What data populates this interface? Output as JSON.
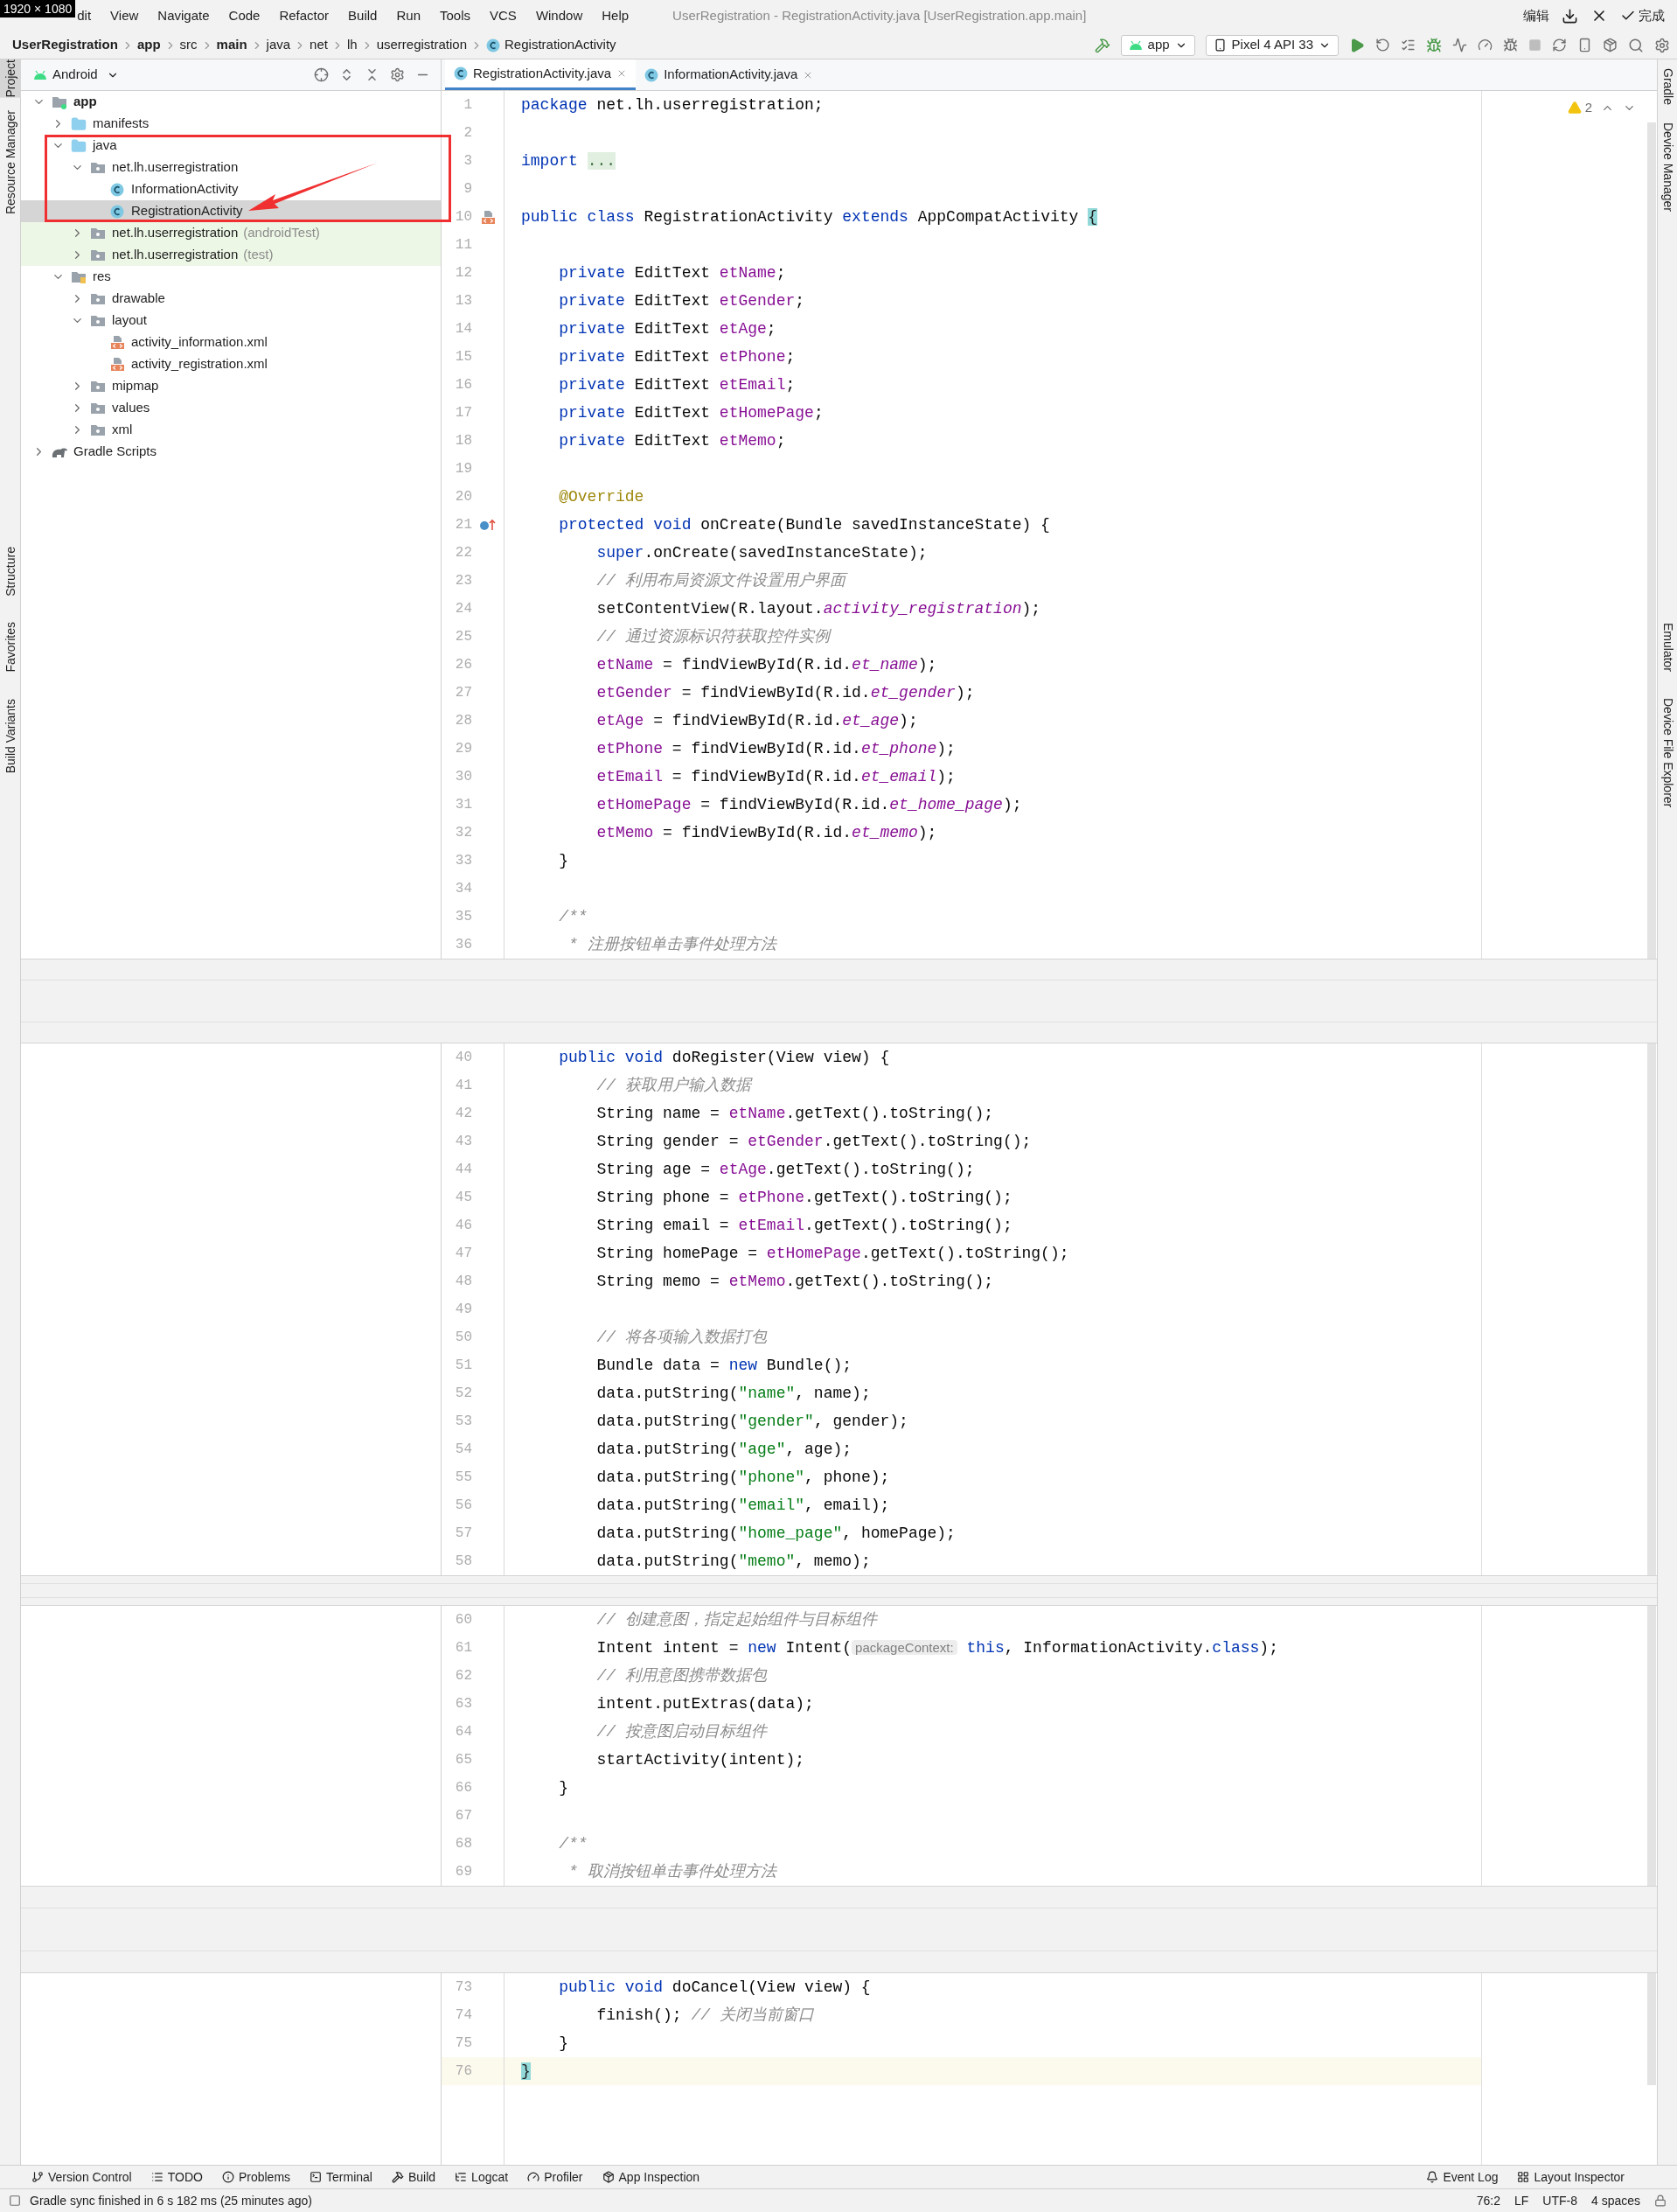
{
  "screen_capture": {
    "size_label": "1920 × 1080",
    "edit_label": "编辑",
    "done_label": "完成"
  },
  "menu": [
    "dit",
    "View",
    "Navigate",
    "Code",
    "Refactor",
    "Build",
    "Run",
    "Tools",
    "VCS",
    "Window",
    "Help"
  ],
  "window": {
    "title": "UserRegistration - RegistrationActivity.java [UserRegistration.app.main]"
  },
  "breadcrumbs": [
    {
      "label": "UserRegistration",
      "bold": true,
      "kind": "plain"
    },
    {
      "label": "app",
      "bold": true,
      "kind": "plain"
    },
    {
      "label": "src",
      "bold": false,
      "kind": "plain"
    },
    {
      "label": "main",
      "bold": true,
      "kind": "plain"
    },
    {
      "label": "java",
      "bold": false,
      "kind": "plain"
    },
    {
      "label": "net",
      "bold": false,
      "kind": "plain"
    },
    {
      "label": "lh",
      "bold": false,
      "kind": "plain"
    },
    {
      "label": "userregistration",
      "bold": false,
      "kind": "plain"
    },
    {
      "label": "RegistrationActivity",
      "bold": false,
      "kind": "class"
    }
  ],
  "toolbar": {
    "run_config": "app",
    "device": "Pixel 4 API 33"
  },
  "left_strip": [
    {
      "label": "Project",
      "selected": true
    },
    {
      "label": "Resource Manager",
      "selected": false
    },
    {
      "label": "Structure",
      "selected": false
    },
    {
      "label": "Favorites",
      "selected": false
    },
    {
      "label": "Build Variants",
      "selected": false
    }
  ],
  "right_strip": [
    {
      "label": "Gradle"
    },
    {
      "label": "Device Manager"
    },
    {
      "label": "Emulator"
    },
    {
      "label": "Device File Explorer"
    }
  ],
  "project": {
    "view": "Android",
    "tree": [
      {
        "label": "app",
        "kind": "module",
        "expanded": true,
        "selected": false,
        "children": [
          {
            "label": "manifests",
            "kind": "folder",
            "expanded": false,
            "selected": false
          },
          {
            "label": "java",
            "kind": "folder",
            "expanded": true,
            "selected": false,
            "children": [
              {
                "label": "net.lh.userregistration",
                "kind": "package",
                "expanded": true,
                "selected": false,
                "children": [
                  {
                    "label": "InformationActivity",
                    "kind": "class",
                    "selected": false
                  },
                  {
                    "label": "RegistrationActivity",
                    "kind": "class",
                    "selected": true
                  }
                ]
              },
              {
                "label": "net.lh.userregistration",
                "suffix": "(androidTest)",
                "kind": "test-package",
                "expanded": false,
                "selected": false
              },
              {
                "label": "net.lh.userregistration",
                "suffix": "(test)",
                "kind": "test-package",
                "expanded": false,
                "selected": false
              }
            ]
          },
          {
            "label": "res",
            "kind": "res-folder",
            "expanded": true,
            "selected": false,
            "children": [
              {
                "label": "drawable",
                "kind": "package",
                "expanded": false,
                "selected": false
              },
              {
                "label": "layout",
                "kind": "package",
                "expanded": true,
                "selected": false,
                "children": [
                  {
                    "label": "activity_information.xml",
                    "kind": "layout-xml",
                    "selected": false
                  },
                  {
                    "label": "activity_registration.xml",
                    "kind": "layout-xml",
                    "selected": false
                  }
                ]
              },
              {
                "label": "mipmap",
                "kind": "package",
                "expanded": false,
                "selected": false
              },
              {
                "label": "values",
                "kind": "package",
                "expanded": false,
                "selected": false
              },
              {
                "label": "xml",
                "kind": "package",
                "expanded": false,
                "selected": false
              }
            ]
          }
        ]
      },
      {
        "label": "Gradle Scripts",
        "kind": "gradle",
        "expanded": false,
        "selected": false
      }
    ]
  },
  "tabs": [
    {
      "label": "RegistrationActivity.java",
      "selected": true
    },
    {
      "label": "InformationActivity.java",
      "selected": false
    }
  ],
  "editor": {
    "warnings": "2",
    "segments": [
      {
        "lines": [
          {
            "number": "1",
            "tokens": [
              {
                "kind": "kw",
                "text": "package "
              },
              {
                "kind": "p",
                "text": "net.lh.userregistration;"
              }
            ]
          },
          {
            "number": "2"
          },
          {
            "number": "3",
            "tokens": [
              {
                "kind": "kw",
                "text": "import "
              },
              {
                "kind": "fold",
                "text": "..."
              }
            ]
          },
          {
            "number": "9"
          },
          {
            "number": "10",
            "kind": "layout-marker",
            "tokens": [
              {
                "kind": "kw",
                "text": "public class "
              },
              {
                "kind": "p",
                "text": "RegistrationActivity "
              },
              {
                "kind": "kw",
                "text": "extends "
              },
              {
                "kind": "p",
                "text": "AppCompatActivity "
              },
              {
                "kind": "brace",
                "text": "{"
              }
            ]
          },
          {
            "number": "11"
          },
          {
            "number": "12",
            "tokens": [
              {
                "kind": "kw",
                "text": "    private "
              },
              {
                "kind": "p",
                "text": "EditText "
              },
              {
                "kind": "fld",
                "text": "etName"
              },
              {
                "kind": "p",
                "text": ";"
              }
            ]
          },
          {
            "number": "13",
            "tokens": [
              {
                "kind": "kw",
                "text": "    private "
              },
              {
                "kind": "p",
                "text": "EditText "
              },
              {
                "kind": "fld",
                "text": "etGender"
              },
              {
                "kind": "p",
                "text": ";"
              }
            ]
          },
          {
            "number": "14",
            "tokens": [
              {
                "kind": "kw",
                "text": "    private "
              },
              {
                "kind": "p",
                "text": "EditText "
              },
              {
                "kind": "fld",
                "text": "etAge"
              },
              {
                "kind": "p",
                "text": ";"
              }
            ]
          },
          {
            "number": "15",
            "tokens": [
              {
                "kind": "kw",
                "text": "    private "
              },
              {
                "kind": "p",
                "text": "EditText "
              },
              {
                "kind": "fld",
                "text": "etPhone"
              },
              {
                "kind": "p",
                "text": ";"
              }
            ]
          },
          {
            "number": "16",
            "tokens": [
              {
                "kind": "kw",
                "text": "    private "
              },
              {
                "kind": "p",
                "text": "EditText "
              },
              {
                "kind": "fld",
                "text": "etEmail"
              },
              {
                "kind": "p",
                "text": ";"
              }
            ]
          },
          {
            "number": "17",
            "tokens": [
              {
                "kind": "kw",
                "text": "    private "
              },
              {
                "kind": "p",
                "text": "EditText "
              },
              {
                "kind": "fld",
                "text": "etHomePage"
              },
              {
                "kind": "p",
                "text": ";"
              }
            ]
          },
          {
            "number": "18",
            "tokens": [
              {
                "kind": "kw",
                "text": "    private "
              },
              {
                "kind": "p",
                "text": "EditText "
              },
              {
                "kind": "fld",
                "text": "etMemo"
              },
              {
                "kind": "p",
                "text": ";"
              }
            ]
          },
          {
            "number": "19"
          },
          {
            "number": "20",
            "tokens": [
              {
                "kind": "ann",
                "text": "    @Override"
              }
            ]
          },
          {
            "number": "21",
            "kind": "override-marker",
            "tokens": [
              {
                "kind": "kw",
                "text": "    protected void "
              },
              {
                "kind": "p",
                "text": "onCreate(Bundle savedInstanceState) {"
              }
            ]
          },
          {
            "number": "22",
            "tokens": [
              {
                "kind": "kw",
                "text": "        super"
              },
              {
                "kind": "p",
                "text": ".onCreate(savedInstanceState);"
              }
            ]
          },
          {
            "number": "23",
            "tokens": [
              {
                "kind": "cm",
                "text": "        // 利用布局资源文件设置用户界面"
              }
            ]
          },
          {
            "number": "24",
            "tokens": [
              {
                "kind": "p",
                "text": "        setContentView(R.layout."
              },
              {
                "kind": "ifld",
                "text": "activity_registration"
              },
              {
                "kind": "p",
                "text": ");"
              }
            ]
          },
          {
            "number": "25",
            "tokens": [
              {
                "kind": "cm",
                "text": "        // 通过资源标识符获取控件实例"
              }
            ]
          },
          {
            "number": "26",
            "tokens": [
              {
                "kind": "fld",
                "text": "        etName"
              },
              {
                "kind": "p",
                "text": " = findViewById(R.id."
              },
              {
                "kind": "ifld",
                "text": "et_name"
              },
              {
                "kind": "p",
                "text": ");"
              }
            ]
          },
          {
            "number": "27",
            "tokens": [
              {
                "kind": "fld",
                "text": "        etGender"
              },
              {
                "kind": "p",
                "text": " = findViewById(R.id."
              },
              {
                "kind": "ifld",
                "text": "et_gender"
              },
              {
                "kind": "p",
                "text": ");"
              }
            ]
          },
          {
            "number": "28",
            "tokens": [
              {
                "kind": "fld",
                "text": "        etAge"
              },
              {
                "kind": "p",
                "text": " = findViewById(R.id."
              },
              {
                "kind": "ifld",
                "text": "et_age"
              },
              {
                "kind": "p",
                "text": ");"
              }
            ]
          },
          {
            "number": "29",
            "tokens": [
              {
                "kind": "fld",
                "text": "        etPhone"
              },
              {
                "kind": "p",
                "text": " = findViewById(R.id."
              },
              {
                "kind": "ifld",
                "text": "et_phone"
              },
              {
                "kind": "p",
                "text": ");"
              }
            ]
          },
          {
            "number": "30",
            "tokens": [
              {
                "kind": "fld",
                "text": "        etEmail"
              },
              {
                "kind": "p",
                "text": " = findViewById(R.id."
              },
              {
                "kind": "ifld",
                "text": "et_email"
              },
              {
                "kind": "p",
                "text": ");"
              }
            ]
          },
          {
            "number": "31",
            "tokens": [
              {
                "kind": "fld",
                "text": "        etHomePage"
              },
              {
                "kind": "p",
                "text": " = findViewById(R.id."
              },
              {
                "kind": "ifld",
                "text": "et_home_page"
              },
              {
                "kind": "p",
                "text": ");"
              }
            ]
          },
          {
            "number": "32",
            "tokens": [
              {
                "kind": "fld",
                "text": "        etMemo"
              },
              {
                "kind": "p",
                "text": " = findViewById(R.id."
              },
              {
                "kind": "ifld",
                "text": "et_memo"
              },
              {
                "kind": "p",
                "text": ");"
              }
            ]
          },
          {
            "number": "33",
            "tokens": [
              {
                "kind": "p",
                "text": "    }"
              }
            ]
          },
          {
            "number": "34"
          },
          {
            "number": "35",
            "tokens": [
              {
                "kind": "cm",
                "text": "    /**"
              }
            ]
          },
          {
            "number": "36",
            "tokens": [
              {
                "kind": "cm",
                "text": "     * 注册按钮单击事件处理方法"
              }
            ]
          }
        ]
      },
      {
        "lines": [
          {
            "number": "40",
            "tokens": [
              {
                "kind": "kw",
                "text": "    public void "
              },
              {
                "kind": "p",
                "text": "doRegister(View view) {"
              }
            ]
          },
          {
            "number": "41",
            "tokens": [
              {
                "kind": "cm",
                "text": "        // 获取用户输入数据"
              }
            ]
          },
          {
            "number": "42",
            "tokens": [
              {
                "kind": "p",
                "text": "        String name = "
              },
              {
                "kind": "fld",
                "text": "etName"
              },
              {
                "kind": "p",
                "text": ".getText().toString();"
              }
            ]
          },
          {
            "number": "43",
            "tokens": [
              {
                "kind": "p",
                "text": "        String gender = "
              },
              {
                "kind": "fld",
                "text": "etGender"
              },
              {
                "kind": "p",
                "text": ".getText().toString();"
              }
            ]
          },
          {
            "number": "44",
            "tokens": [
              {
                "kind": "p",
                "text": "        String age = "
              },
              {
                "kind": "fld",
                "text": "etAge"
              },
              {
                "kind": "p",
                "text": ".getText().toString();"
              }
            ]
          },
          {
            "number": "45",
            "tokens": [
              {
                "kind": "p",
                "text": "        String phone = "
              },
              {
                "kind": "fld",
                "text": "etPhone"
              },
              {
                "kind": "p",
                "text": ".getText().toString();"
              }
            ]
          },
          {
            "number": "46",
            "tokens": [
              {
                "kind": "p",
                "text": "        String email = "
              },
              {
                "kind": "fld",
                "text": "etEmail"
              },
              {
                "kind": "p",
                "text": ".getText().toString();"
              }
            ]
          },
          {
            "number": "47",
            "tokens": [
              {
                "kind": "p",
                "text": "        String homePage = "
              },
              {
                "kind": "fld",
                "text": "etHomePage"
              },
              {
                "kind": "p",
                "text": ".getText().toString();"
              }
            ]
          },
          {
            "number": "48",
            "tokens": [
              {
                "kind": "p",
                "text": "        String memo = "
              },
              {
                "kind": "fld",
                "text": "etMemo"
              },
              {
                "kind": "p",
                "text": ".getText().toString();"
              }
            ]
          },
          {
            "number": "49"
          },
          {
            "number": "50",
            "tokens": [
              {
                "kind": "cm",
                "text": "        // 将各项输入数据打包"
              }
            ]
          },
          {
            "number": "51",
            "tokens": [
              {
                "kind": "p",
                "text": "        Bundle data = "
              },
              {
                "kind": "kw",
                "text": "new "
              },
              {
                "kind": "p",
                "text": "Bundle();"
              }
            ]
          },
          {
            "number": "52",
            "tokens": [
              {
                "kind": "p",
                "text": "        data.putString("
              },
              {
                "kind": "str",
                "text": "\"name\""
              },
              {
                "kind": "p",
                "text": ", name);"
              }
            ]
          },
          {
            "number": "53",
            "tokens": [
              {
                "kind": "p",
                "text": "        data.putString("
              },
              {
                "kind": "str",
                "text": "\"gender\""
              },
              {
                "kind": "p",
                "text": ", gender);"
              }
            ]
          },
          {
            "number": "54",
            "tokens": [
              {
                "kind": "p",
                "text": "        data.putString("
              },
              {
                "kind": "str",
                "text": "\"age\""
              },
              {
                "kind": "p",
                "text": ", age);"
              }
            ]
          },
          {
            "number": "55",
            "tokens": [
              {
                "kind": "p",
                "text": "        data.putString("
              },
              {
                "kind": "str",
                "text": "\"phone\""
              },
              {
                "kind": "p",
                "text": ", phone);"
              }
            ]
          },
          {
            "number": "56",
            "tokens": [
              {
                "kind": "p",
                "text": "        data.putString("
              },
              {
                "kind": "str",
                "text": "\"email\""
              },
              {
                "kind": "p",
                "text": ", email);"
              }
            ]
          },
          {
            "number": "57",
            "tokens": [
              {
                "kind": "p",
                "text": "        data.putString("
              },
              {
                "kind": "str",
                "text": "\"home_page\""
              },
              {
                "kind": "p",
                "text": ", homePage);"
              }
            ]
          },
          {
            "number": "58",
            "tokens": [
              {
                "kind": "p",
                "text": "        data.putString("
              },
              {
                "kind": "str",
                "text": "\"memo\""
              },
              {
                "kind": "p",
                "text": ", memo);"
              }
            ]
          }
        ]
      },
      {
        "lines": [
          {
            "number": "60",
            "tokens": [
              {
                "kind": "cm",
                "text": "        // 创建意图，指定起始组件与目标组件"
              }
            ]
          },
          {
            "number": "61",
            "tokens": [
              {
                "kind": "p",
                "text": "        Intent intent = "
              },
              {
                "kind": "kw",
                "text": "new "
              },
              {
                "kind": "p",
                "text": "Intent("
              },
              {
                "kind": "hint",
                "text": "packageContext:"
              },
              {
                "kind": "kw",
                "text": " this"
              },
              {
                "kind": "p",
                "text": ", InformationActivity."
              },
              {
                "kind": "kw",
                "text": "class"
              },
              {
                "kind": "p",
                "text": ");"
              }
            ]
          },
          {
            "number": "62",
            "tokens": [
              {
                "kind": "cm",
                "text": "        // 利用意图携带数据包"
              }
            ]
          },
          {
            "number": "63",
            "tokens": [
              {
                "kind": "p",
                "text": "        intent.putExtras(data);"
              }
            ]
          },
          {
            "number": "64",
            "tokens": [
              {
                "kind": "cm",
                "text": "        // 按意图启动目标组件"
              }
            ]
          },
          {
            "number": "65",
            "tokens": [
              {
                "kind": "p",
                "text": "        startActivity(intent);"
              }
            ]
          },
          {
            "number": "66",
            "tokens": [
              {
                "kind": "p",
                "text": "    }"
              }
            ]
          },
          {
            "number": "67"
          },
          {
            "number": "68",
            "tokens": [
              {
                "kind": "cm",
                "text": "    /**"
              }
            ]
          },
          {
            "number": "69",
            "tokens": [
              {
                "kind": "cm",
                "text": "     * 取消按钮单击事件处理方法"
              }
            ]
          }
        ]
      },
      {
        "lines": [
          {
            "number": "73",
            "tokens": [
              {
                "kind": "kw",
                "text": "    public void "
              },
              {
                "kind": "p",
                "text": "doCancel(View view) {"
              }
            ]
          },
          {
            "number": "74",
            "tokens": [
              {
                "kind": "p",
                "text": "        finish(); "
              },
              {
                "kind": "cm",
                "text": "// 关闭当前窗口"
              }
            ]
          },
          {
            "number": "75",
            "tokens": [
              {
                "kind": "p",
                "text": "    }"
              }
            ]
          },
          {
            "number": "76",
            "current": true,
            "tokens": [
              {
                "kind": "brace",
                "text": "}"
              }
            ]
          }
        ]
      }
    ]
  },
  "bottom_tools": {
    "left": [
      "Version Control",
      "TODO",
      "Problems",
      "Terminal",
      "Build",
      "Logcat",
      "Profiler",
      "App Inspection"
    ],
    "right": [
      "Event Log",
      "Layout Inspector"
    ]
  },
  "status_bar": {
    "message": "Gradle sync finished in 6 s 182 ms (25 minutes ago)",
    "position": "76:2",
    "line_separator": "LF",
    "encoding": "UTF-8",
    "indent": "4 spaces"
  }
}
